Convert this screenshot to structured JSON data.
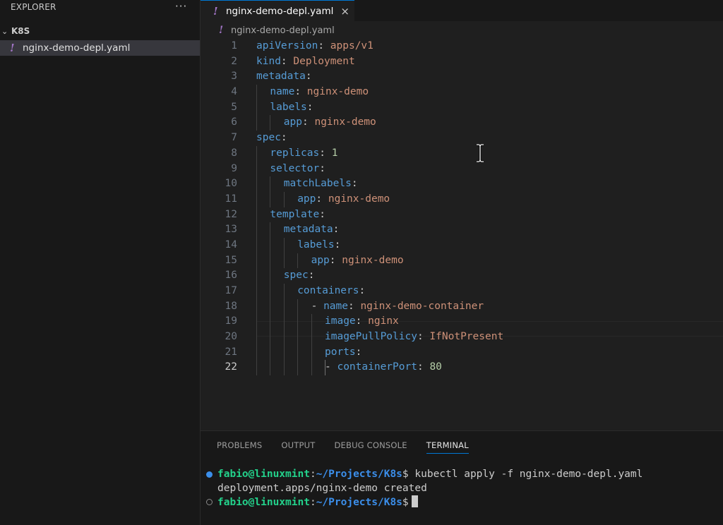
{
  "sidebar": {
    "title": "EXPLORER",
    "more_label": "···",
    "folder": {
      "chevron": "⌄",
      "name": "K8S"
    },
    "files": [
      {
        "glyph": "!",
        "name": "nginx-demo-depl.yaml"
      }
    ]
  },
  "editor": {
    "tab": {
      "glyph": "!",
      "label": "nginx-demo-depl.yaml",
      "close": "×"
    },
    "breadcrumb": {
      "glyph": "!",
      "label": "nginx-demo-depl.yaml"
    },
    "active_line": "22",
    "lines": [
      {
        "n": "1",
        "indent": 0,
        "dash": false,
        "key": "apiVersion",
        "value": "apps/v1",
        "type": "str"
      },
      {
        "n": "2",
        "indent": 0,
        "dash": false,
        "key": "kind",
        "value": "Deployment",
        "type": "str"
      },
      {
        "n": "3",
        "indent": 0,
        "dash": false,
        "key": "metadata",
        "value": "",
        "type": "none"
      },
      {
        "n": "4",
        "indent": 1,
        "dash": false,
        "key": "name",
        "value": "nginx-demo",
        "type": "str"
      },
      {
        "n": "5",
        "indent": 1,
        "dash": false,
        "key": "labels",
        "value": "",
        "type": "none"
      },
      {
        "n": "6",
        "indent": 2,
        "dash": false,
        "key": "app",
        "value": "nginx-demo",
        "type": "str"
      },
      {
        "n": "7",
        "indent": 0,
        "dash": false,
        "key": "spec",
        "value": "",
        "type": "none"
      },
      {
        "n": "8",
        "indent": 1,
        "dash": false,
        "key": "replicas",
        "value": "1",
        "type": "num"
      },
      {
        "n": "9",
        "indent": 1,
        "dash": false,
        "key": "selector",
        "value": "",
        "type": "none"
      },
      {
        "n": "10",
        "indent": 2,
        "dash": false,
        "key": "matchLabels",
        "value": "",
        "type": "none"
      },
      {
        "n": "11",
        "indent": 3,
        "dash": false,
        "key": "app",
        "value": "nginx-demo",
        "type": "str"
      },
      {
        "n": "12",
        "indent": 1,
        "dash": false,
        "key": "template",
        "value": "",
        "type": "none"
      },
      {
        "n": "13",
        "indent": 2,
        "dash": false,
        "key": "metadata",
        "value": "",
        "type": "none"
      },
      {
        "n": "14",
        "indent": 3,
        "dash": false,
        "key": "labels",
        "value": "",
        "type": "none"
      },
      {
        "n": "15",
        "indent": 4,
        "dash": false,
        "key": "app",
        "value": "nginx-demo",
        "type": "str"
      },
      {
        "n": "16",
        "indent": 2,
        "dash": false,
        "key": "spec",
        "value": "",
        "type": "none"
      },
      {
        "n": "17",
        "indent": 3,
        "dash": false,
        "key": "containers",
        "value": "",
        "type": "none"
      },
      {
        "n": "18",
        "indent": 4,
        "dash": true,
        "key": "name",
        "value": "nginx-demo-container",
        "type": "str"
      },
      {
        "n": "19",
        "indent": 5,
        "dash": false,
        "key": "image",
        "value": "nginx",
        "type": "str"
      },
      {
        "n": "20",
        "indent": 5,
        "dash": false,
        "key": "imagePullPolicy",
        "value": "IfNotPresent",
        "type": "str"
      },
      {
        "n": "21",
        "indent": 5,
        "dash": false,
        "key": "ports",
        "value": "",
        "type": "none"
      },
      {
        "n": "22",
        "indent": 5,
        "dash": true,
        "key": "containerPort",
        "value": "80",
        "type": "num"
      }
    ]
  },
  "panel": {
    "tabs": [
      {
        "label": "PROBLEMS",
        "active": false
      },
      {
        "label": "OUTPUT",
        "active": false
      },
      {
        "label": "DEBUG CONSOLE",
        "active": false
      },
      {
        "label": "TERMINAL",
        "active": true
      }
    ],
    "terminal": {
      "lines": [
        {
          "kind": "prompt",
          "dot": "filled",
          "user": "fabio@linuxmint",
          "sep": ":",
          "path": "~/Projects/K8s",
          "suffix": "$ ",
          "command": "kubectl apply -f nginx-demo-depl.yaml",
          "cursor": false
        },
        {
          "kind": "output",
          "text": "deployment.apps/nginx-demo created"
        },
        {
          "kind": "prompt",
          "dot": "hollow",
          "user": "fabio@linuxmint",
          "sep": ":",
          "path": "~/Projects/K8s",
          "suffix": "$",
          "command": "",
          "cursor": true
        }
      ]
    }
  },
  "colors": {
    "key": "#569cd6",
    "string": "#ce9178",
    "number": "#b5cea8",
    "prompt_user": "#23d18b",
    "prompt_path": "#3b8eea",
    "yaml_icon": "#a074c4",
    "accent": "#0078d4"
  }
}
